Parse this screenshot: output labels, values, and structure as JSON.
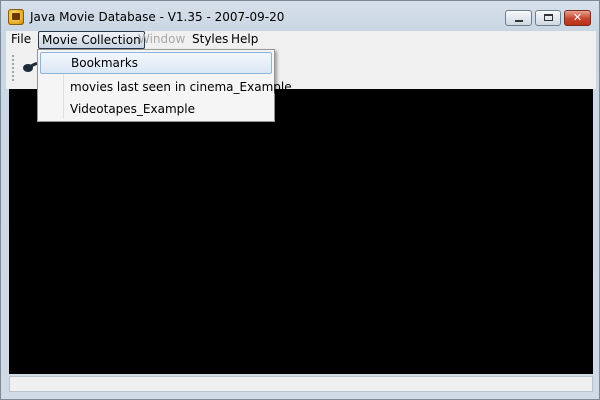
{
  "window": {
    "title": "Java Movie Database - V1.35 - 2007-09-20",
    "close_glyph": "✕"
  },
  "menubar": {
    "items": [
      {
        "label": "File",
        "enabled": true
      },
      {
        "label": "Movie Collection",
        "enabled": true,
        "open": true
      },
      {
        "label": "Window",
        "enabled": false
      },
      {
        "label": "Styles",
        "enabled": true
      },
      {
        "label": "Help",
        "enabled": true
      }
    ]
  },
  "dropdown": {
    "items": [
      {
        "label": "Bookmarks",
        "selected": true
      },
      {
        "label": "movies last seen in cinema_Example",
        "selected": false
      },
      {
        "label": "Videotapes_Example",
        "selected": false
      }
    ]
  },
  "toolbar": {
    "icon": "film-reel-icon"
  },
  "colors": {
    "content_background": "#000000",
    "selection_border": "#8fb4da",
    "disabled_text": "#a8a8a8"
  }
}
